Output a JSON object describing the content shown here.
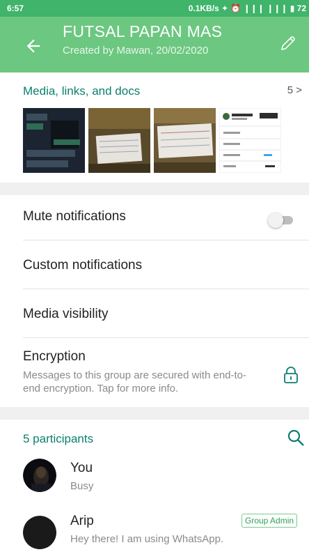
{
  "statusbar": {
    "time": "6:57",
    "right_info": "0.1KB/s ✦ ⏰ ❙❙❙ ❙❙❙ ▮ 72"
  },
  "header": {
    "title": "FUTSAL PAPAN MAS",
    "subtitle": "Created by Mawan, 20/02/2020"
  },
  "media": {
    "title": "Media, links, and docs",
    "count": "5 >"
  },
  "settings": {
    "mute": "Mute notifications",
    "custom": "Custom notifications",
    "visibility": "Media visibility",
    "encryption_title": "Encryption",
    "encryption_desc": "Messages to this group are secured with end-to-end encryption. Tap for more info."
  },
  "participants": {
    "title": "5 participants",
    "list": [
      {
        "name": "You",
        "status": "Busy"
      },
      {
        "name": "Arip",
        "status": "Hey there! I am using WhatsApp.",
        "badge": "Group Admin"
      }
    ]
  },
  "colors": {
    "appbar": "#6cc780",
    "statusbar": "#3fb46a",
    "accent": "#0b7f70"
  }
}
